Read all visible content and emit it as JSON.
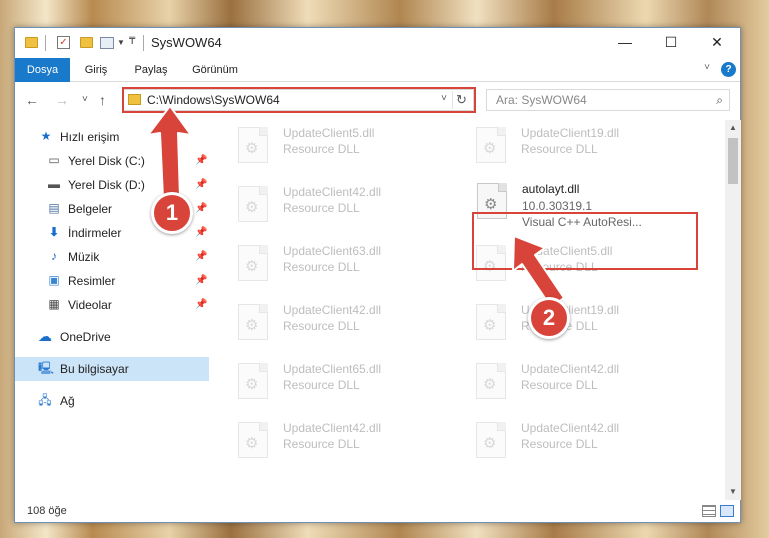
{
  "window": {
    "title": "SysWOW64",
    "minimize": "—",
    "maximize": "☐",
    "close": "✕"
  },
  "ribbon": {
    "tabs": [
      "Dosya",
      "Giriş",
      "Paylaş",
      "Görünüm"
    ],
    "active_tab": "Dosya",
    "help": "?"
  },
  "nav": {
    "back": "←",
    "forward": "→",
    "recent": "˅",
    "up": "↑",
    "address": "C:\\Windows\\SysWOW64",
    "refresh": "↻",
    "search_placeholder": "Ara: SysWOW64"
  },
  "sidebar": {
    "items": [
      {
        "label": "Hızlı erişim",
        "icon": "star-icon",
        "pinned": false
      },
      {
        "label": "Yerel Disk (C:)",
        "icon": "drive-icon",
        "pinned": true
      },
      {
        "label": "Yerel Disk (D:)",
        "icon": "drive-icon",
        "pinned": true
      },
      {
        "label": "Belgeler",
        "icon": "documents-icon",
        "pinned": true
      },
      {
        "label": "İndirmeler",
        "icon": "download-icon",
        "pinned": true
      },
      {
        "label": "Müzik",
        "icon": "music-icon",
        "pinned": true
      },
      {
        "label": "Resimler",
        "icon": "pictures-icon",
        "pinned": true
      },
      {
        "label": "Videolar",
        "icon": "videos-icon",
        "pinned": true
      },
      {
        "label": "OneDrive",
        "icon": "cloud-icon",
        "pinned": false
      },
      {
        "label": "Bu bilgisayar",
        "icon": "computer-icon",
        "pinned": false,
        "selected": true
      },
      {
        "label": "Ağ",
        "icon": "network-icon",
        "pinned": false
      }
    ]
  },
  "files": {
    "left": [
      {
        "name": "UpdateClient5.dll",
        "desc": "Resource DLL"
      },
      {
        "name": "UpdateClient42.dll",
        "desc": "Resource DLL"
      },
      {
        "name": "UpdateClient63.dll",
        "desc": "Resource DLL"
      },
      {
        "name": "UpdateClient42.dll",
        "desc": "Resource DLL"
      },
      {
        "name": "UpdateClient65.dll",
        "desc": "Resource DLL"
      },
      {
        "name": "UpdateClient42.dll",
        "desc": "Resource DLL"
      }
    ],
    "right": [
      {
        "name": "UpdateClient19.dll",
        "desc": "Resource DLL"
      },
      {
        "name": "autolayt.dll",
        "version": "10.0.30319.1",
        "desc": "Visual C++ AutoResi...",
        "highlighted": true
      },
      {
        "name": "UpdateClient5.dll",
        "desc": "Resource DLL"
      },
      {
        "name": "UpdateClient19.dll",
        "desc": "Resource DLL"
      },
      {
        "name": "UpdateClient42.dll",
        "desc": "Resource DLL"
      },
      {
        "name": "UpdateClient42.dll",
        "desc": "Resource DLL"
      }
    ]
  },
  "status": {
    "count": "108 öğe"
  },
  "annotations": {
    "badge1": "1",
    "badge2": "2",
    "color": "#d9443a"
  }
}
